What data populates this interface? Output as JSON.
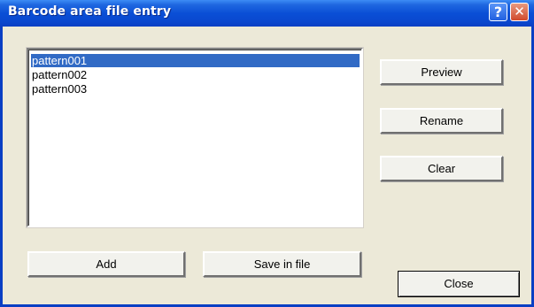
{
  "window": {
    "title": "Barcode area file entry",
    "help_glyph": "?",
    "close_glyph": "✕"
  },
  "list": {
    "items": [
      "pattern001",
      "pattern002",
      "pattern003"
    ],
    "selected_index": 0
  },
  "buttons": {
    "preview": "Preview",
    "rename": "Rename",
    "clear": "Clear",
    "add": "Add",
    "save": "Save in file",
    "close": "Close"
  },
  "colors": {
    "titlebar": "#0a4fd6",
    "selection": "#316ac5",
    "dialog_bg": "#ece9d8"
  }
}
